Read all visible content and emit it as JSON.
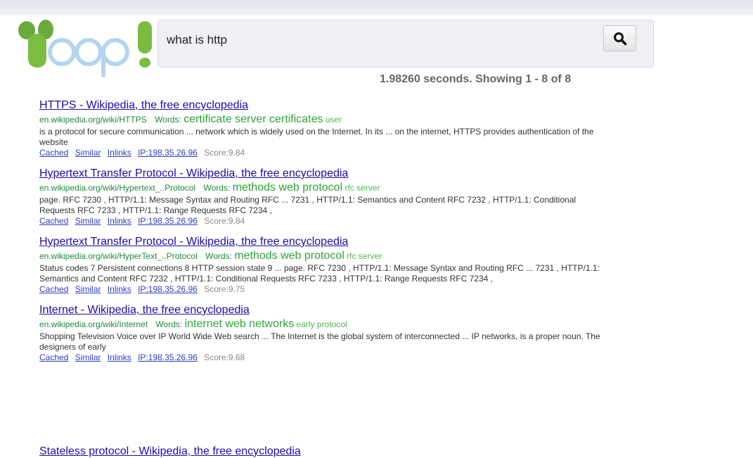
{
  "search": {
    "query": "what is http",
    "button": "search-icon"
  },
  "stats": "1.98260 seconds. Showing 1 - 8 of 8",
  "colors": {
    "title_link": "#1a0dab",
    "url_green": "#1f8a3b",
    "keyword_green": "#2fa33a",
    "logo_green": "#7bbd3f",
    "logo_blue": "#b3d5f0"
  },
  "results": [
    {
      "title": "HTTPS - Wikipedia, the free encyclopedia",
      "url": "en.wikipedia.org/wiki/HTTPS",
      "words_label": "Words:",
      "keywords": "certificate server certificates",
      "keywords_extra": "user",
      "snippet": "is a protocol for secure communication ... network which is widely used on the Internet. In its ... on the internet, HTTPS provides authentication of the website",
      "cached": "Cached",
      "similar": "Similar",
      "inlinks": "Inlinks",
      "ip": "IP:198.35.26.96",
      "score": "Score:9.84"
    },
    {
      "title": "Hypertext Transfer Protocol - Wikipedia, the free encyclopedia",
      "url": "en.wikipedia.org/wiki/Hypertext_..Protocol",
      "words_label": "Words:",
      "keywords": "methods web protocol",
      "keywords_extra": "rfc server",
      "snippet": "page. RFC 7230 , HTTP/1.1: Message Syntax and Routing RFC ... 7231 , HTTP/1.1: Semantics and Content RFC 7232 , HTTP/1.1: Conditional Requests RFC 7233 , HTTP/1.1: Range Requests RFC 7234 ,",
      "cached": "Cached",
      "similar": "Similar",
      "inlinks": "Inlinks",
      "ip": "IP:198.35.26.96",
      "score": "Score:9.84"
    },
    {
      "title": "Hypertext Transfer Protocol - Wikipedia, the free encyclopedia",
      "url": "en.wikipedia.org/wiki/HyperText_..Protocol",
      "words_label": "Words:",
      "keywords": "methods web protocol",
      "keywords_extra": "rfc server",
      "snippet": "Status codes 7 Persistent connections 8 HTTP session state 9 ... page. RFC 7230 , HTTP/1.1: Message Syntax and Routing RFC ... 7231 , HTTP/1.1: Semantics and Content RFC 7232 , HTTP/1.1: Conditional Requests RFC 7233 , HTTP/1.1: Range Requests RFC 7234 ,",
      "cached": "Cached",
      "similar": "Similar",
      "inlinks": "Inlinks",
      "ip": "IP:198.35.26.96",
      "score": "Score:9.75"
    },
    {
      "title": "Internet - Wikipedia, the free encyclopedia",
      "url": "en.wikipedia.org/wiki/Internet",
      "words_label": "Words:",
      "keywords": "internet web networks",
      "keywords_extra": "early protocol",
      "snippet": "Shopping Television Voice over IP World Wide Web search ... The Internet is the global system of interconnected ... IP networks, is a proper noun. The designers of early",
      "cached": "Cached",
      "similar": "Similar",
      "inlinks": "Inlinks",
      "ip": "IP:198.35.26.96",
      "score": "Score:9.68"
    }
  ],
  "partial_result_title": "Stateless protocol - Wikipedia, the free encyclopedia"
}
